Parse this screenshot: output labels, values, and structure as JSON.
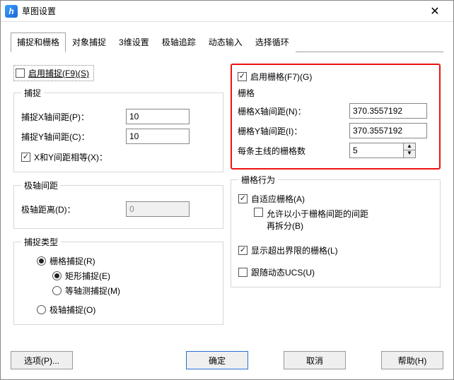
{
  "window": {
    "title": "草图设置"
  },
  "tabs": [
    "捕捉和栅格",
    "对象捕捉",
    "3维设置",
    "极轴追踪",
    "动态输入",
    "选择循环"
  ],
  "left": {
    "enable_snap": "启用捕捉(F9)(S)",
    "snap_group": "捕捉",
    "snap_x_label": "捕捉X轴间距(P)：",
    "snap_x_value": "10",
    "snap_y_label": "捕捉Y轴间距(C)：",
    "snap_y_value": "10",
    "equal_xy": "X和Y间距相等(X)：",
    "polar_group": "极轴间距",
    "polar_dist_label": "极轴距离(D)：",
    "polar_dist_value": "0",
    "type_group": "捕捉类型",
    "r_grid_snap": "栅格捕捉(R)",
    "r_rect_snap": "矩形捕捉(E)",
    "r_iso_snap": "等轴测捕捉(M)",
    "r_polar_snap": "极轴捕捉(O)"
  },
  "right": {
    "enable_grid": "启用栅格(F7)(G)",
    "grid_group": "栅格",
    "grid_x_label": "栅格X轴间距(N)：",
    "grid_x_value": "370.3557192",
    "grid_y_label": "栅格Y轴间距(I)：",
    "grid_y_value": "370.3557192",
    "major_label": "每条主线的栅格数",
    "major_value": "5",
    "behavior_group": "栅格行为",
    "adaptive": "自适应栅格(A)",
    "subdivide1": "允许以小于栅格间距的间距",
    "subdivide2": "再拆分(B)",
    "beyond": "显示超出界限的栅格(L)",
    "follow_ucs": "跟随动态UCS(U)"
  },
  "buttons": {
    "options": "选项(P)...",
    "ok": "确定",
    "cancel": "取消",
    "help": "帮助(H)"
  }
}
